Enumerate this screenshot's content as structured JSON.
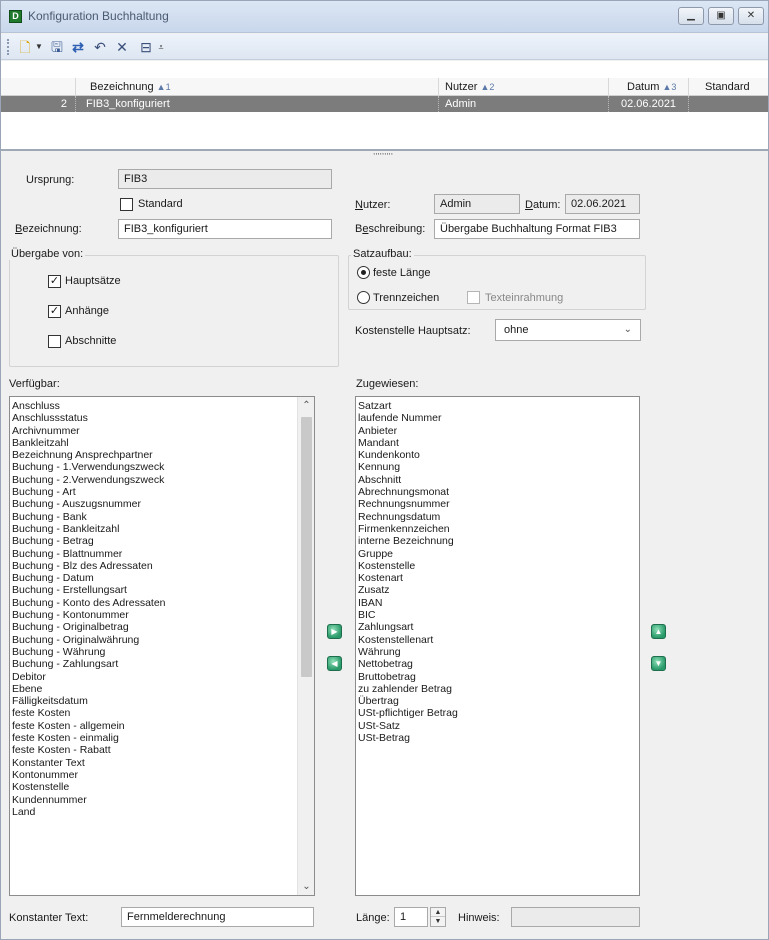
{
  "window": {
    "title": "Konfiguration Buchhaltung",
    "app_icon": "D"
  },
  "grid": {
    "columns": [
      {
        "label": "Bezeichnung",
        "sort": "▲1"
      },
      {
        "label": "Nutzer",
        "sort": "▲2"
      },
      {
        "label": "Datum",
        "sort": "▲3"
      },
      {
        "label": "Standard",
        "sort": ""
      }
    ],
    "rows": [
      {
        "nr": "2",
        "bezeichnung": "FIB3_konfiguriert",
        "nutzer": "Admin",
        "datum": "02.06.2021",
        "standard": ""
      }
    ]
  },
  "form": {
    "ursprung_label": "Ursprung:",
    "ursprung_value": "FIB3",
    "standard_label": "Standard",
    "bezeichnung_label": "Bezeichnung:",
    "bezeichnung_value": "FIB3_konfiguriert",
    "nutzer_label": "Nutzer:",
    "nutzer_value": "Admin",
    "datum_label": "Datum:",
    "datum_value": "02.06.2021",
    "beschreibung_label": "Beschreibung:",
    "beschreibung_value": "Übergabe Buchhaltung Format FIB3",
    "uebergabe_title": "Übergabe von:",
    "hauptsaetze_label": "Hauptsätze",
    "anhaenge_label": "Anhänge",
    "abschnitte_label": "Abschnitte",
    "satzaufbau_title": "Satzaufbau:",
    "feste_laenge_label": "feste Länge",
    "trennzeichen_label": "Trennzeichen",
    "texteinrahmung_label": "Texteinrahmung",
    "kostenstelle_label": "Kostenstelle Hauptsatz:",
    "kostenstelle_value": "ohne",
    "verfuegbar_label": "Verfügbar:",
    "zugewiesen_label": "Zugewiesen:",
    "konstanter_text_label": "Konstanter Text:",
    "konstanter_text_value": "Fernmelderechnung",
    "laenge_label": "Länge:",
    "laenge_value": "1",
    "hinweis_label": "Hinweis:",
    "hinweis_value": ""
  },
  "verfuegbar_items": [
    "Anschluss",
    "Anschlussstatus",
    "Archivnummer",
    "Bankleitzahl",
    "Bezeichnung Ansprechpartner",
    "Buchung - 1.Verwendungszweck",
    "Buchung - 2.Verwendungszweck",
    "Buchung - Art",
    "Buchung - Auszugsnummer",
    "Buchung - Bank",
    "Buchung - Bankleitzahl",
    "Buchung - Betrag",
    "Buchung - Blattnummer",
    "Buchung - Blz des Adressaten",
    "Buchung - Datum",
    "Buchung - Erstellungsart",
    "Buchung - Konto des Adressaten",
    "Buchung - Kontonummer",
    "Buchung - Originalbetrag",
    "Buchung - Originalwährung",
    "Buchung - Währung",
    "Buchung - Zahlungsart",
    "Debitor",
    "Ebene",
    "Fälligkeitsdatum",
    "feste Kosten",
    "feste Kosten - allgemein",
    "feste Kosten - einmalig",
    "feste Kosten - Rabatt",
    "Konstanter Text",
    "Kontonummer",
    "Kostenstelle",
    "Kundennummer",
    "Land"
  ],
  "zugewiesen_items": [
    "Satzart",
    "laufende Nummer",
    "Anbieter",
    "Mandant",
    "Kundenkonto",
    "Kennung",
    "Abschnitt",
    "Abrechnungsmonat",
    "Rechnungsnummer",
    "Rechnungsdatum",
    "Firmenkennzeichen",
    "interne Bezeichnung",
    "Gruppe",
    "Kostenstelle",
    "Kostenart",
    "Zusatz",
    "IBAN",
    "BIC",
    "Zahlungsart",
    "Kostenstellenart",
    "Währung",
    "Nettobetrag",
    "Bruttobetrag",
    "zu zahlender Betrag",
    "Übertrag",
    "USt-pflichtiger Betrag",
    "USt-Satz",
    "USt-Betrag"
  ]
}
